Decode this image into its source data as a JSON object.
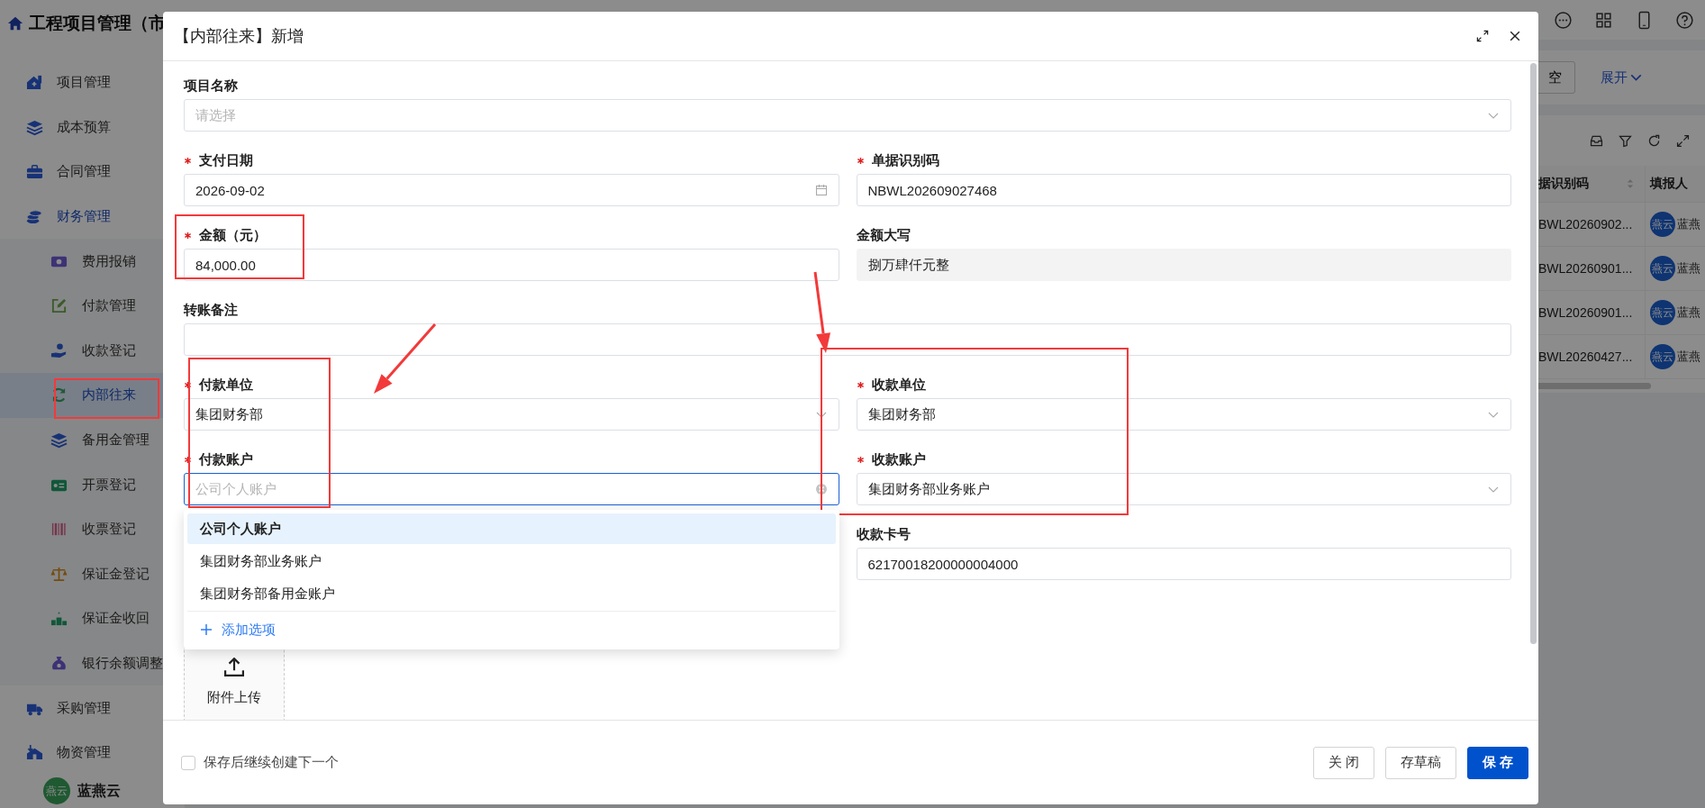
{
  "app": {
    "title": "工程项目管理（市",
    "user": {
      "avatar": "燕云",
      "name": "蓝燕云"
    }
  },
  "sidebar": {
    "items": [
      {
        "label": "项目管理",
        "selected": false
      },
      {
        "label": "成本预算",
        "selected": false
      },
      {
        "label": "合同管理",
        "selected": false
      },
      {
        "label": "财务管理",
        "selected": false,
        "expanded": true,
        "children": [
          {
            "label": "费用报销",
            "selected": false
          },
          {
            "label": "付款管理",
            "selected": false
          },
          {
            "label": "收款登记",
            "selected": false
          },
          {
            "label": "内部往来",
            "selected": true
          },
          {
            "label": "备用金管理",
            "selected": false
          },
          {
            "label": "开票登记",
            "selected": false
          },
          {
            "label": "收票登记",
            "selected": false
          },
          {
            "label": "保证金登记",
            "selected": false
          },
          {
            "label": "保证金收回",
            "selected": false
          },
          {
            "label": "银行余额调整",
            "selected": false
          }
        ]
      },
      {
        "label": "采购管理",
        "selected": false
      },
      {
        "label": "物资管理",
        "selected": false
      }
    ]
  },
  "filter_bar": {
    "reset_label": "空",
    "expand_label": "展开"
  },
  "table": {
    "columns": [
      {
        "label": "据识别码",
        "sortable": true
      },
      {
        "label": "填报人",
        "sortable": false
      }
    ],
    "rows": [
      {
        "code": "BWL20260902...",
        "avatar": "燕云",
        "name": "蓝燕"
      },
      {
        "code": "BWL20260901...",
        "avatar": "燕云",
        "name": "蓝燕"
      },
      {
        "code": "BWL20260901...",
        "avatar": "燕云",
        "name": "蓝燕"
      },
      {
        "code": "BWL20260427...",
        "avatar": "燕云",
        "name": "蓝燕"
      }
    ]
  },
  "dialog": {
    "title": "【内部往来】新增",
    "rows": [
      {
        "full": {
          "label": "项目名称",
          "required": false,
          "kind": "select",
          "placeholder": "请选择"
        }
      },
      {
        "left": {
          "label": "支付日期",
          "required": true,
          "kind": "date",
          "value": "2026-09-02"
        },
        "right": {
          "label": "单据识别码",
          "required": true,
          "kind": "text",
          "value": "NBWL202609027468"
        }
      },
      {
        "left": {
          "label": "金额（元）",
          "required": true,
          "kind": "text",
          "value": "84,000.00"
        },
        "right": {
          "label": "金额大写",
          "required": false,
          "kind": "readonly",
          "value": "捌万肆仟元整"
        }
      },
      {
        "full": {
          "label": "转账备注",
          "required": false,
          "kind": "text"
        }
      },
      {
        "left": {
          "label": "付款单位",
          "required": true,
          "kind": "select",
          "value": "集团财务部"
        },
        "right": {
          "label": "收款单位",
          "required": true,
          "kind": "select",
          "value": "集团财务部"
        }
      },
      {
        "left": {
          "label": "付款账户",
          "required": true,
          "kind": "select",
          "placeholder": "公司个人账户",
          "focused": true,
          "open": true,
          "options": [
            {
              "label": "公司个人账户",
              "selected": true
            },
            {
              "label": "集团财务部业务账户",
              "selected": false
            },
            {
              "label": "集团财务部备用金账户",
              "selected": false
            }
          ],
          "add_label": "添加选项"
        },
        "right": {
          "label": "收款账户",
          "required": true,
          "kind": "select",
          "value": "集团财务部业务账户"
        }
      },
      {
        "right": {
          "label": "收款卡号",
          "required": false,
          "kind": "text",
          "value": "62170018200000004000"
        }
      }
    ],
    "upload": {
      "label": "附件上传"
    },
    "footer": {
      "checkbox": {
        "label": "保存后继续创建下一个",
        "checked": false
      },
      "buttons": [
        {
          "label": "关 闭",
          "kind": "default"
        },
        {
          "label": "存草稿",
          "kind": "default"
        },
        {
          "label": "保 存",
          "kind": "primary"
        }
      ]
    }
  }
}
